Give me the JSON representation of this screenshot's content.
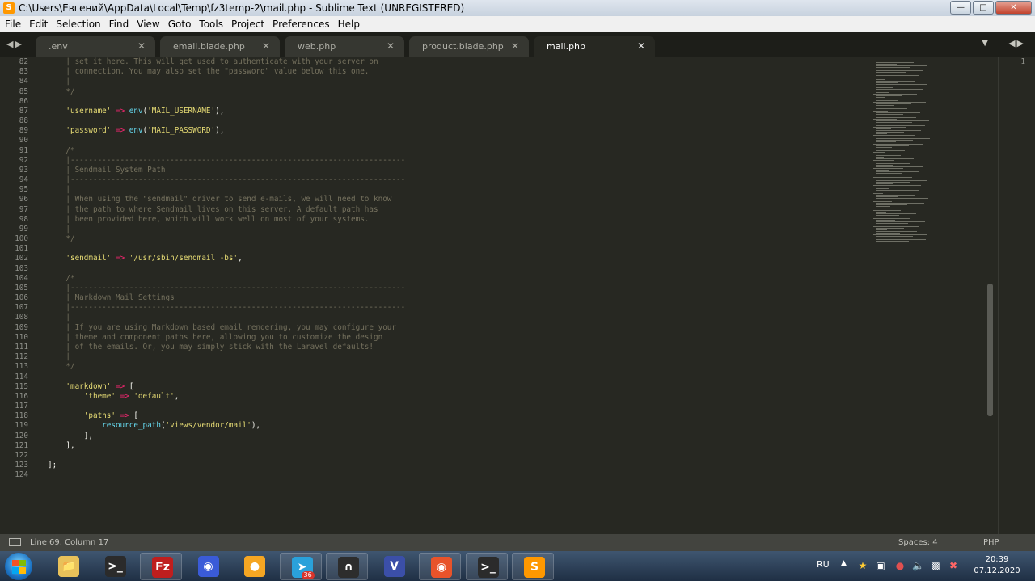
{
  "window": {
    "title": "C:\\Users\\Евгений\\AppData\\Local\\Temp\\fz3temp-2\\mail.php - Sublime Text (UNREGISTERED)"
  },
  "menu": [
    "File",
    "Edit",
    "Selection",
    "Find",
    "View",
    "Goto",
    "Tools",
    "Project",
    "Preferences",
    "Help"
  ],
  "tabs": [
    {
      "label": ".env",
      "active": false
    },
    {
      "label": "email.blade.php",
      "active": false
    },
    {
      "label": "web.php",
      "active": false
    },
    {
      "label": "product.blade.php",
      "active": false
    },
    {
      "label": "mail.php",
      "active": true
    }
  ],
  "editor": {
    "lines": [
      {
        "n": "82",
        "t": [
          [
            "cm",
            "    | set it here. This will get used to authenticate with your server on"
          ]
        ]
      },
      {
        "n": "83",
        "t": [
          [
            "cm",
            "    | connection. You may also set the \"password\" value below this one."
          ]
        ]
      },
      {
        "n": "84",
        "t": [
          [
            "cm",
            "    |"
          ]
        ]
      },
      {
        "n": "85",
        "t": [
          [
            "cm",
            "    */"
          ]
        ]
      },
      {
        "n": "86",
        "t": []
      },
      {
        "n": "87",
        "t": [
          [
            "st",
            "    'username'"
          ],
          [
            "op",
            " => "
          ],
          [
            "fn",
            "env"
          ],
          [
            "pn",
            "("
          ],
          [
            "st",
            "'MAIL_USERNAME'"
          ],
          [
            "pn",
            "),"
          ]
        ]
      },
      {
        "n": "88",
        "t": []
      },
      {
        "n": "89",
        "t": [
          [
            "st",
            "    'password'"
          ],
          [
            "op",
            " => "
          ],
          [
            "fn",
            "env"
          ],
          [
            "pn",
            "("
          ],
          [
            "st",
            "'MAIL_PASSWORD'"
          ],
          [
            "pn",
            "),"
          ]
        ]
      },
      {
        "n": "90",
        "t": []
      },
      {
        "n": "91",
        "t": [
          [
            "cm",
            "    /*"
          ]
        ]
      },
      {
        "n": "92",
        "t": [
          [
            "cm",
            "    |--------------------------------------------------------------------------"
          ]
        ]
      },
      {
        "n": "93",
        "t": [
          [
            "cm",
            "    | Sendmail System Path"
          ]
        ]
      },
      {
        "n": "94",
        "t": [
          [
            "cm",
            "    |--------------------------------------------------------------------------"
          ]
        ]
      },
      {
        "n": "95",
        "t": [
          [
            "cm",
            "    |"
          ]
        ]
      },
      {
        "n": "96",
        "t": [
          [
            "cm",
            "    | When using the \"sendmail\" driver to send e-mails, we will need to know"
          ]
        ]
      },
      {
        "n": "97",
        "t": [
          [
            "cm",
            "    | the path to where Sendmail lives on this server. A default path has"
          ]
        ]
      },
      {
        "n": "98",
        "t": [
          [
            "cm",
            "    | been provided here, which will work well on most of your systems."
          ]
        ]
      },
      {
        "n": "99",
        "t": [
          [
            "cm",
            "    |"
          ]
        ]
      },
      {
        "n": "100",
        "t": [
          [
            "cm",
            "    */"
          ]
        ]
      },
      {
        "n": "101",
        "t": []
      },
      {
        "n": "102",
        "t": [
          [
            "st",
            "    'sendmail'"
          ],
          [
            "op",
            " => "
          ],
          [
            "st",
            "'/usr/sbin/sendmail -bs'"
          ],
          [
            "pn",
            ","
          ]
        ]
      },
      {
        "n": "103",
        "t": []
      },
      {
        "n": "104",
        "t": [
          [
            "cm",
            "    /*"
          ]
        ]
      },
      {
        "n": "105",
        "t": [
          [
            "cm",
            "    |--------------------------------------------------------------------------"
          ]
        ]
      },
      {
        "n": "106",
        "t": [
          [
            "cm",
            "    | Markdown Mail Settings"
          ]
        ]
      },
      {
        "n": "107",
        "t": [
          [
            "cm",
            "    |--------------------------------------------------------------------------"
          ]
        ]
      },
      {
        "n": "108",
        "t": [
          [
            "cm",
            "    |"
          ]
        ]
      },
      {
        "n": "109",
        "t": [
          [
            "cm",
            "    | If you are using Markdown based email rendering, you may configure your"
          ]
        ]
      },
      {
        "n": "110",
        "t": [
          [
            "cm",
            "    | theme and component paths here, allowing you to customize the design"
          ]
        ]
      },
      {
        "n": "111",
        "t": [
          [
            "cm",
            "    | of the emails. Or, you may simply stick with the Laravel defaults!"
          ]
        ]
      },
      {
        "n": "112",
        "t": [
          [
            "cm",
            "    |"
          ]
        ]
      },
      {
        "n": "113",
        "t": [
          [
            "cm",
            "    */"
          ]
        ]
      },
      {
        "n": "114",
        "t": []
      },
      {
        "n": "115",
        "t": [
          [
            "st",
            "    'markdown'"
          ],
          [
            "op",
            " => "
          ],
          [
            "pn",
            "["
          ]
        ]
      },
      {
        "n": "116",
        "t": [
          [
            "st",
            "        'theme'"
          ],
          [
            "op",
            " => "
          ],
          [
            "st",
            "'default'"
          ],
          [
            "pn",
            ","
          ]
        ]
      },
      {
        "n": "117",
        "t": []
      },
      {
        "n": "118",
        "t": [
          [
            "st",
            "        'paths'"
          ],
          [
            "op",
            " => "
          ],
          [
            "pn",
            "["
          ]
        ]
      },
      {
        "n": "119",
        "t": [
          [
            "fn",
            "            resource_path"
          ],
          [
            "pn",
            "("
          ],
          [
            "st",
            "'views/vendor/mail'"
          ],
          [
            "pn",
            "),"
          ]
        ]
      },
      {
        "n": "120",
        "t": [
          [
            "pn",
            "        ],"
          ]
        ]
      },
      {
        "n": "121",
        "t": [
          [
            "pn",
            "    ],"
          ]
        ]
      },
      {
        "n": "122",
        "t": []
      },
      {
        "n": "123",
        "t": [
          [
            "pn",
            "];"
          ]
        ]
      },
      {
        "n": "124",
        "t": []
      }
    ]
  },
  "right_pane": {
    "line_number": "1"
  },
  "status": {
    "position": "Line 69, Column 17",
    "spaces": "Spaces: 4",
    "syntax": "PHP"
  },
  "taskbar": {
    "apps": [
      {
        "name": "file-explorer",
        "icon": "folder-icon",
        "color": "#e8c15a",
        "open": false
      },
      {
        "name": "terminal",
        "icon": "terminal-icon",
        "color": "#2b2b2b",
        "open": false
      },
      {
        "name": "filezilla",
        "icon": "filezilla-icon",
        "color": "#bf1e1e",
        "open": true
      },
      {
        "name": "firefox-dev",
        "icon": "firefox-icon",
        "color": "#3a5bd8",
        "open": false
      },
      {
        "name": "chrome-like",
        "icon": "circle-app-icon",
        "color": "#f5a623",
        "open": false
      },
      {
        "name": "telegram",
        "icon": "telegram-icon",
        "color": "#2aa1da",
        "open": true,
        "badge": "36"
      },
      {
        "name": "vpn",
        "icon": "vpn-icon",
        "color": "#2d2d2d",
        "open": true
      },
      {
        "name": "editor-v",
        "icon": "v-app-icon",
        "color": "#3b4fa8",
        "open": false
      },
      {
        "name": "firefox",
        "icon": "firefox-icon",
        "color": "#e8532a",
        "open": true
      },
      {
        "name": "terminal-2",
        "icon": "terminal-icon",
        "color": "#2b2b2b",
        "open": true
      },
      {
        "name": "sublime-text",
        "icon": "sublime-icon",
        "color": "#ff9800",
        "open": true
      }
    ],
    "tray": {
      "language": "RU",
      "time": "20:39",
      "date": "07.12.2020"
    }
  }
}
